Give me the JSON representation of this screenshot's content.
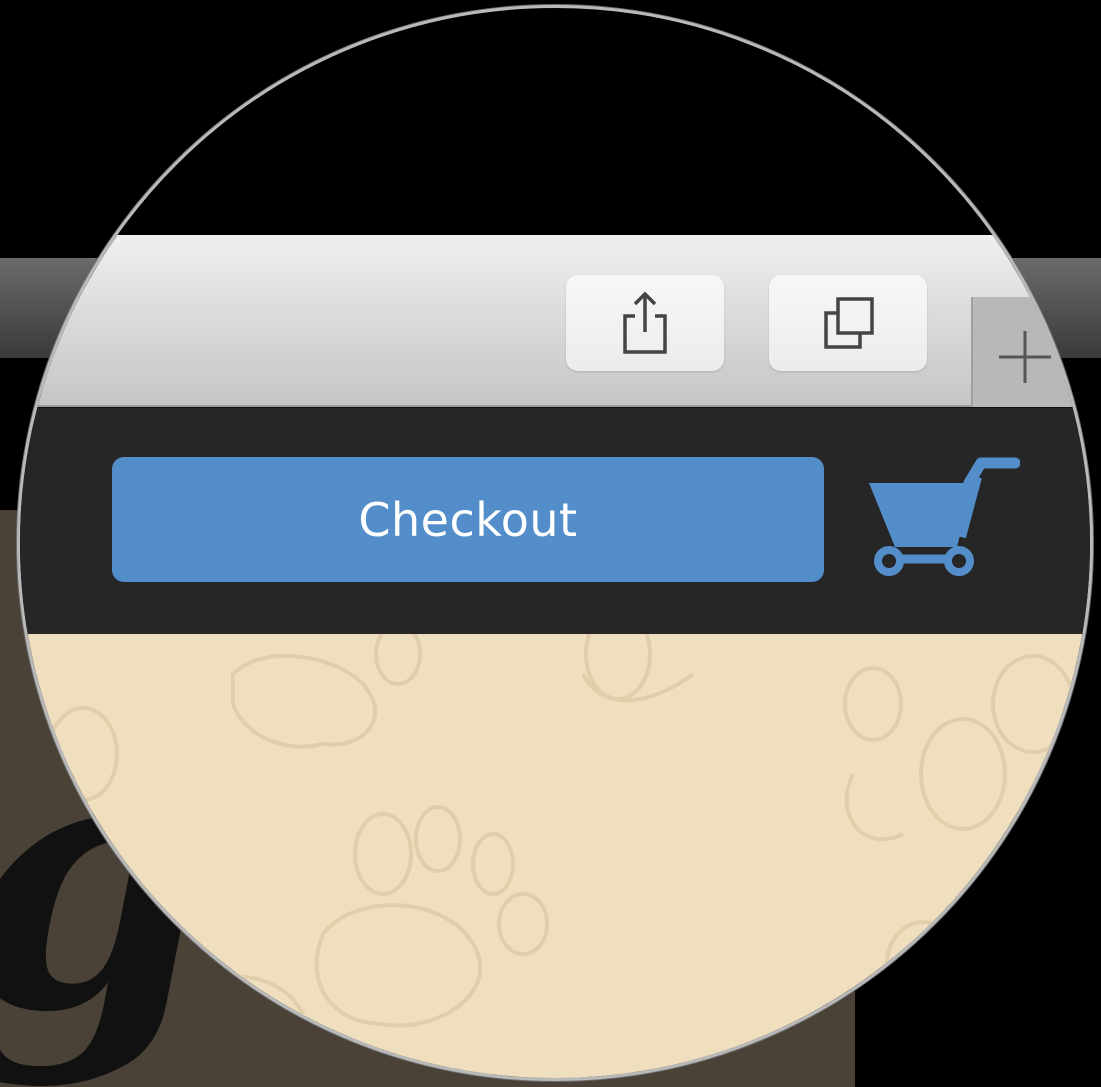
{
  "header": {
    "checkout_label": "Checkout"
  },
  "toolbar": {
    "buttons": [
      "share-icon",
      "tabs-icon",
      "new-tab-icon"
    ]
  },
  "colors": {
    "checkout_button": "#538ecb",
    "cart_icon": "#538ecb",
    "header_bg": "#262626",
    "toolbar_bg": "#dcdcdc",
    "content_bg": "#efdfbf"
  }
}
